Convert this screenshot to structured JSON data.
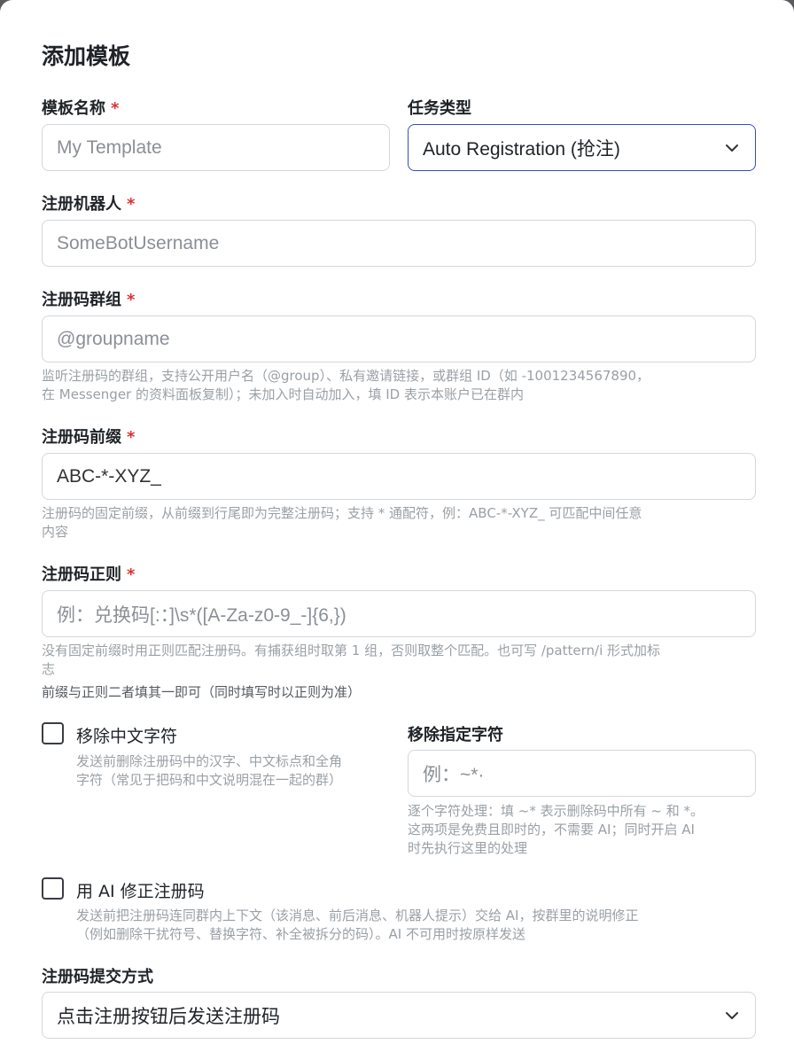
{
  "dialog": {
    "title": "添加模板"
  },
  "template_name": {
    "label": "模板名称",
    "required": "*",
    "placeholder": "My Template"
  },
  "task_type": {
    "label": "任务类型",
    "value": "Auto Registration (抢注)"
  },
  "bot": {
    "label": "注册机器人",
    "required": "*",
    "placeholder": "SomeBotUsername"
  },
  "group": {
    "label": "注册码群组",
    "required": "*",
    "placeholder": "@groupname",
    "help_line1": "监听注册码的群组，支持公开用户名（@group）、私有邀请链接，或群组 ID（如 -1001234567890，",
    "help_line2": "在 Messenger 的资料面板复制）；未加入时自动加入，填 ID 表示本账户已在群内"
  },
  "prefix": {
    "label": "注册码前缀",
    "required": "*",
    "value": "ABC-*-XYZ_",
    "help_line1": "注册码的固定前缀，从前缀到行尾即为完整注册码；支持 * 通配符，例：ABC-*-XYZ_ 可匹配中间任意",
    "help_line2": "内容"
  },
  "regex": {
    "label": "注册码正则",
    "required": "*",
    "placeholder": "例：兑换码[:：]\\s*([A-Za-z0-9_-]{6,})",
    "help_line1": "没有固定前缀时用正则匹配注册码。有捕获组时取第 1 组，否则取整个匹配。也可写 /pattern/i 形式加标",
    "help_line2": "志",
    "help_note": "前缀与正则二者填其一即可（同时填写时以正则为准）"
  },
  "remove_chinese": {
    "label": "移除中文字符",
    "help_line1": "发送前删除注册码中的汉字、中文标点和全角",
    "help_line2": "字符（常见于把码和中文说明混在一起的群）"
  },
  "remove_chars": {
    "label": "移除指定字符",
    "placeholder": "例：~*·",
    "help_line1": "逐个字符处理：填 ~* 表示删除码中所有 ~ 和 *。",
    "help_line2": "这两项是免费且即时的，不需要 AI；同时开启 AI",
    "help_line3": "时先执行这里的处理"
  },
  "ai_fix": {
    "label": "用 AI 修正注册码",
    "help_line1": "发送前把注册码连同群内上下文（该消息、前后消息、机器人提示）交给 AI，按群里的说明修正",
    "help_line2": "（例如删除干扰符号、替换字符、补全被拆分的码）。AI 不可用时按原样发送"
  },
  "submit_mode": {
    "label": "注册码提交方式",
    "value": "点击注册按钮后发送注册码"
  },
  "colors": {
    "required": "#e03131",
    "focus_border": "#3b4cc0",
    "help_text": "#9aa0a6"
  }
}
